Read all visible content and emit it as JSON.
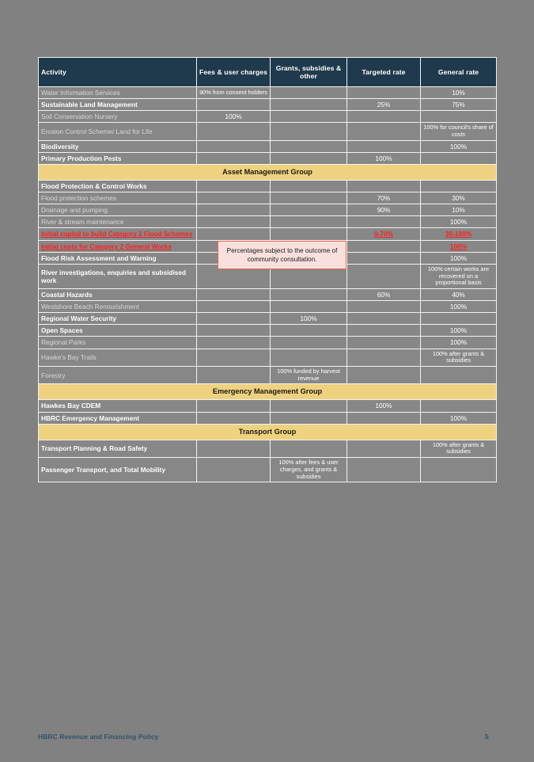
{
  "document": {
    "footer_title": "HBRC Revenue and Financing Policy",
    "page_number": "5"
  },
  "callout": {
    "text": "Percentages subject to the outcome of community consultation."
  },
  "table": {
    "columns": [
      "Activity",
      "Fees & user charges",
      "Grants, subsidies & other",
      "Targeted rate",
      "General rate"
    ],
    "rows": [
      {
        "kind": "data",
        "level": 2,
        "activity": "Water Information Services",
        "fees": "90% from consent holders",
        "grants": "",
        "targeted": "",
        "general": "10%"
      },
      {
        "kind": "data",
        "level": 1,
        "activity": "Sustainable Land Management",
        "fees": "",
        "grants": "",
        "targeted": "25%",
        "general": "75%"
      },
      {
        "kind": "data",
        "level": 2,
        "activity": "Soil Conservation Nursery",
        "fees": "100%",
        "grants": "",
        "targeted": "",
        "general": ""
      },
      {
        "kind": "data",
        "level": 2,
        "activity": "Erosion Control Scheme/      Land for Life",
        "fees": "",
        "grants": "",
        "targeted": "",
        "general": "100% for council's share of costs"
      },
      {
        "kind": "data",
        "level": 1,
        "activity": "Biodiversity",
        "fees": "",
        "grants": "",
        "targeted": "",
        "general": "100%"
      },
      {
        "kind": "data",
        "level": 1,
        "activity": "Primary Production Pests",
        "fees": "",
        "grants": "",
        "targeted": "100%",
        "general": ""
      },
      {
        "kind": "group",
        "activity": "Asset Management Group"
      },
      {
        "kind": "data",
        "level": 1,
        "activity": "Flood Protection & Control Works",
        "fees": "",
        "grants": "",
        "targeted": "",
        "general": ""
      },
      {
        "kind": "data",
        "level": 2,
        "activity": "Flood protection schemes",
        "fees": "",
        "grants": "",
        "targeted": "70%",
        "general": "30%"
      },
      {
        "kind": "data",
        "level": 2,
        "activity": "Drainage and pumping",
        "fees": "",
        "grants": "",
        "targeted": "90%",
        "general": "10%"
      },
      {
        "kind": "data",
        "level": 2,
        "activity": "River & stream maintenance",
        "fees": "",
        "grants": "",
        "targeted": "",
        "general": "100%"
      },
      {
        "kind": "data",
        "level": 2,
        "tracked": true,
        "activity": "Initial capital to build Category 2 Flood Schemes",
        "fees": "",
        "grants": "",
        "targeted": "0-70%",
        "general": "30-100%"
      },
      {
        "kind": "data",
        "level": 2,
        "tracked": true,
        "activity": "Initial costs for Category 2 General Works",
        "fees": "",
        "grants": "",
        "targeted": "",
        "general": "100%"
      },
      {
        "kind": "data",
        "level": 1,
        "activity": "Flood Risk Assessment and Warning",
        "fees": "",
        "grants": "",
        "targeted": "",
        "general": "100%"
      },
      {
        "kind": "data",
        "level": 1,
        "activity": "River investigations, enquiries and subsidised work",
        "fees": "",
        "grants": "",
        "targeted": "",
        "general": "100% certain works are recovered on a proportional basis"
      },
      {
        "kind": "data",
        "level": 1,
        "activity": "Coastal Hazards",
        "fees": "",
        "grants": "",
        "targeted": "60%",
        "general": "40%"
      },
      {
        "kind": "data",
        "level": 2,
        "activity": "Westshore Beach Renourishment",
        "fees": "",
        "grants": "",
        "targeted": "",
        "general": "100%"
      },
      {
        "kind": "data",
        "level": 1,
        "activity": "Regional Water Security",
        "fees": "",
        "grants": "100%",
        "targeted": "",
        "general": ""
      },
      {
        "kind": "data",
        "level": 1,
        "activity": "Open Spaces",
        "fees": "",
        "grants": "",
        "targeted": "",
        "general": "100%"
      },
      {
        "kind": "data",
        "level": 2,
        "activity": "Regional  Parks",
        "fees": "",
        "grants": "",
        "targeted": "",
        "general": "100%"
      },
      {
        "kind": "data",
        "level": 2,
        "activity": "Hawke's Bay Trails",
        "fees": "",
        "grants": "",
        "targeted": "",
        "general": "100% after grants & subsidies"
      },
      {
        "kind": "data",
        "level": 2,
        "activity": "Forestry",
        "fees": "",
        "grants": "100% funded by harvest revenue",
        "targeted": "",
        "general": ""
      },
      {
        "kind": "group",
        "activity": "Emergency Management Group"
      },
      {
        "kind": "data",
        "level": 1,
        "activity": "Hawkes Bay CDEM",
        "fees": "",
        "grants": "",
        "targeted": "100%",
        "general": ""
      },
      {
        "kind": "data",
        "level": 1,
        "activity": "HBRC Emergency Management",
        "fees": "",
        "grants": "",
        "targeted": "",
        "general": "100%"
      },
      {
        "kind": "group",
        "activity": "Transport Group"
      },
      {
        "kind": "data",
        "level": 1,
        "activity": "Transport Planning & Road Safety",
        "fees": "",
        "grants": "",
        "targeted": "",
        "general": "100% after grants & subsidies"
      },
      {
        "kind": "data",
        "level": 1,
        "activity": "Passenger Transport, and Total Mobility",
        "fees": "",
        "grants": "100% after fees & user charges, and grants & subsidies",
        "targeted": "",
        "general": ""
      }
    ]
  },
  "colors": {
    "page_background": "#818181",
    "header_navy": "#1f3a4d",
    "cell_gray": "#878787",
    "group_yellow": "#efd27f",
    "tracked_red": "#ff1f1f",
    "callout_fill": "#fae0dc",
    "callout_border": "#e8664a",
    "footer_text": "#2f5168"
  }
}
